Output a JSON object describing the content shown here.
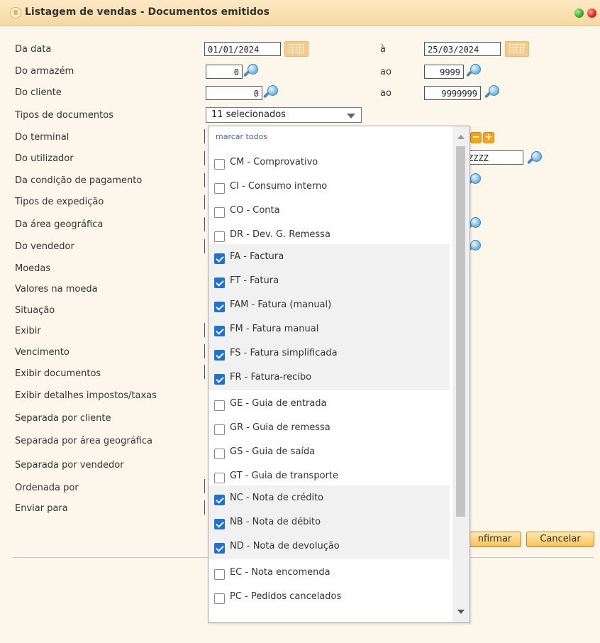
{
  "window": {
    "title": "Listagem de vendas - Documentos emitidos",
    "status_colors": {
      "green": "#239c1b",
      "red": "#d11313"
    }
  },
  "form": {
    "labels": [
      "Da data",
      "Do armazém",
      "Do cliente",
      "Tipos de documentos",
      "Do terminal",
      "Do utilizador",
      "Da condição de pagamento",
      "Tipos de expedição",
      "Da área geográfica",
      "Do vendedor",
      "Moedas",
      "Valores na moeda",
      "Situação",
      "Exibir",
      "Vencimento",
      "Exibir documentos",
      "Exibir detalhes impostos/taxas",
      "Separada por cliente",
      "Separada por área geográfica",
      "Separada por vendedor",
      "Ordenada por",
      "Enviar para"
    ],
    "date_from": "01/01/2024",
    "date_to_label": "à",
    "date_to": "25/03/2024",
    "warehouse_from": "0",
    "warehouse_to_label": "ao",
    "warehouse_to": "9999",
    "client_from": "0",
    "client_to_label": "ao",
    "client_to": "9999999",
    "user_to": "ZZZZ",
    "doc_types_selected": "11 selecionados"
  },
  "dropdown": {
    "mark_all": "marcar todos",
    "options": [
      {
        "label": "CM - Comprovativo",
        "checked": false
      },
      {
        "label": "CI - Consumo interno",
        "checked": false
      },
      {
        "label": "CO - Conta",
        "checked": false
      },
      {
        "label": "DR - Dev. G. Remessa",
        "checked": false
      },
      {
        "label": "FA - Factura",
        "checked": true
      },
      {
        "label": "FT - Fatura",
        "checked": true
      },
      {
        "label": "FAM - Fatura (manual)",
        "checked": true
      },
      {
        "label": "FM - Fatura manual",
        "checked": true
      },
      {
        "label": "FS - Fatura simplificada",
        "checked": true
      },
      {
        "label": "FR - Fatura-recibo",
        "checked": true
      },
      {
        "label": "GE - Guia de entrada",
        "checked": false
      },
      {
        "label": "GR - Guia de remessa",
        "checked": false
      },
      {
        "label": "GS - Guia de saída",
        "checked": false
      },
      {
        "label": "GT - Guia de transporte",
        "checked": false
      },
      {
        "label": "NC - Nota de crédito",
        "checked": true
      },
      {
        "label": "NB - Nota de débito",
        "checked": true
      },
      {
        "label": "ND - Nota de devolução",
        "checked": true
      },
      {
        "label": "EC - Nota encomenda",
        "checked": false
      },
      {
        "label": "PC - Pedidos cancelados",
        "checked": false
      }
    ]
  },
  "buttons": {
    "confirm": "nfirmar",
    "cancel": "Cancelar"
  },
  "icons": [
    "calendar-icon",
    "search-icon",
    "minus-icon",
    "plus-icon",
    "chevron-down-icon"
  ]
}
